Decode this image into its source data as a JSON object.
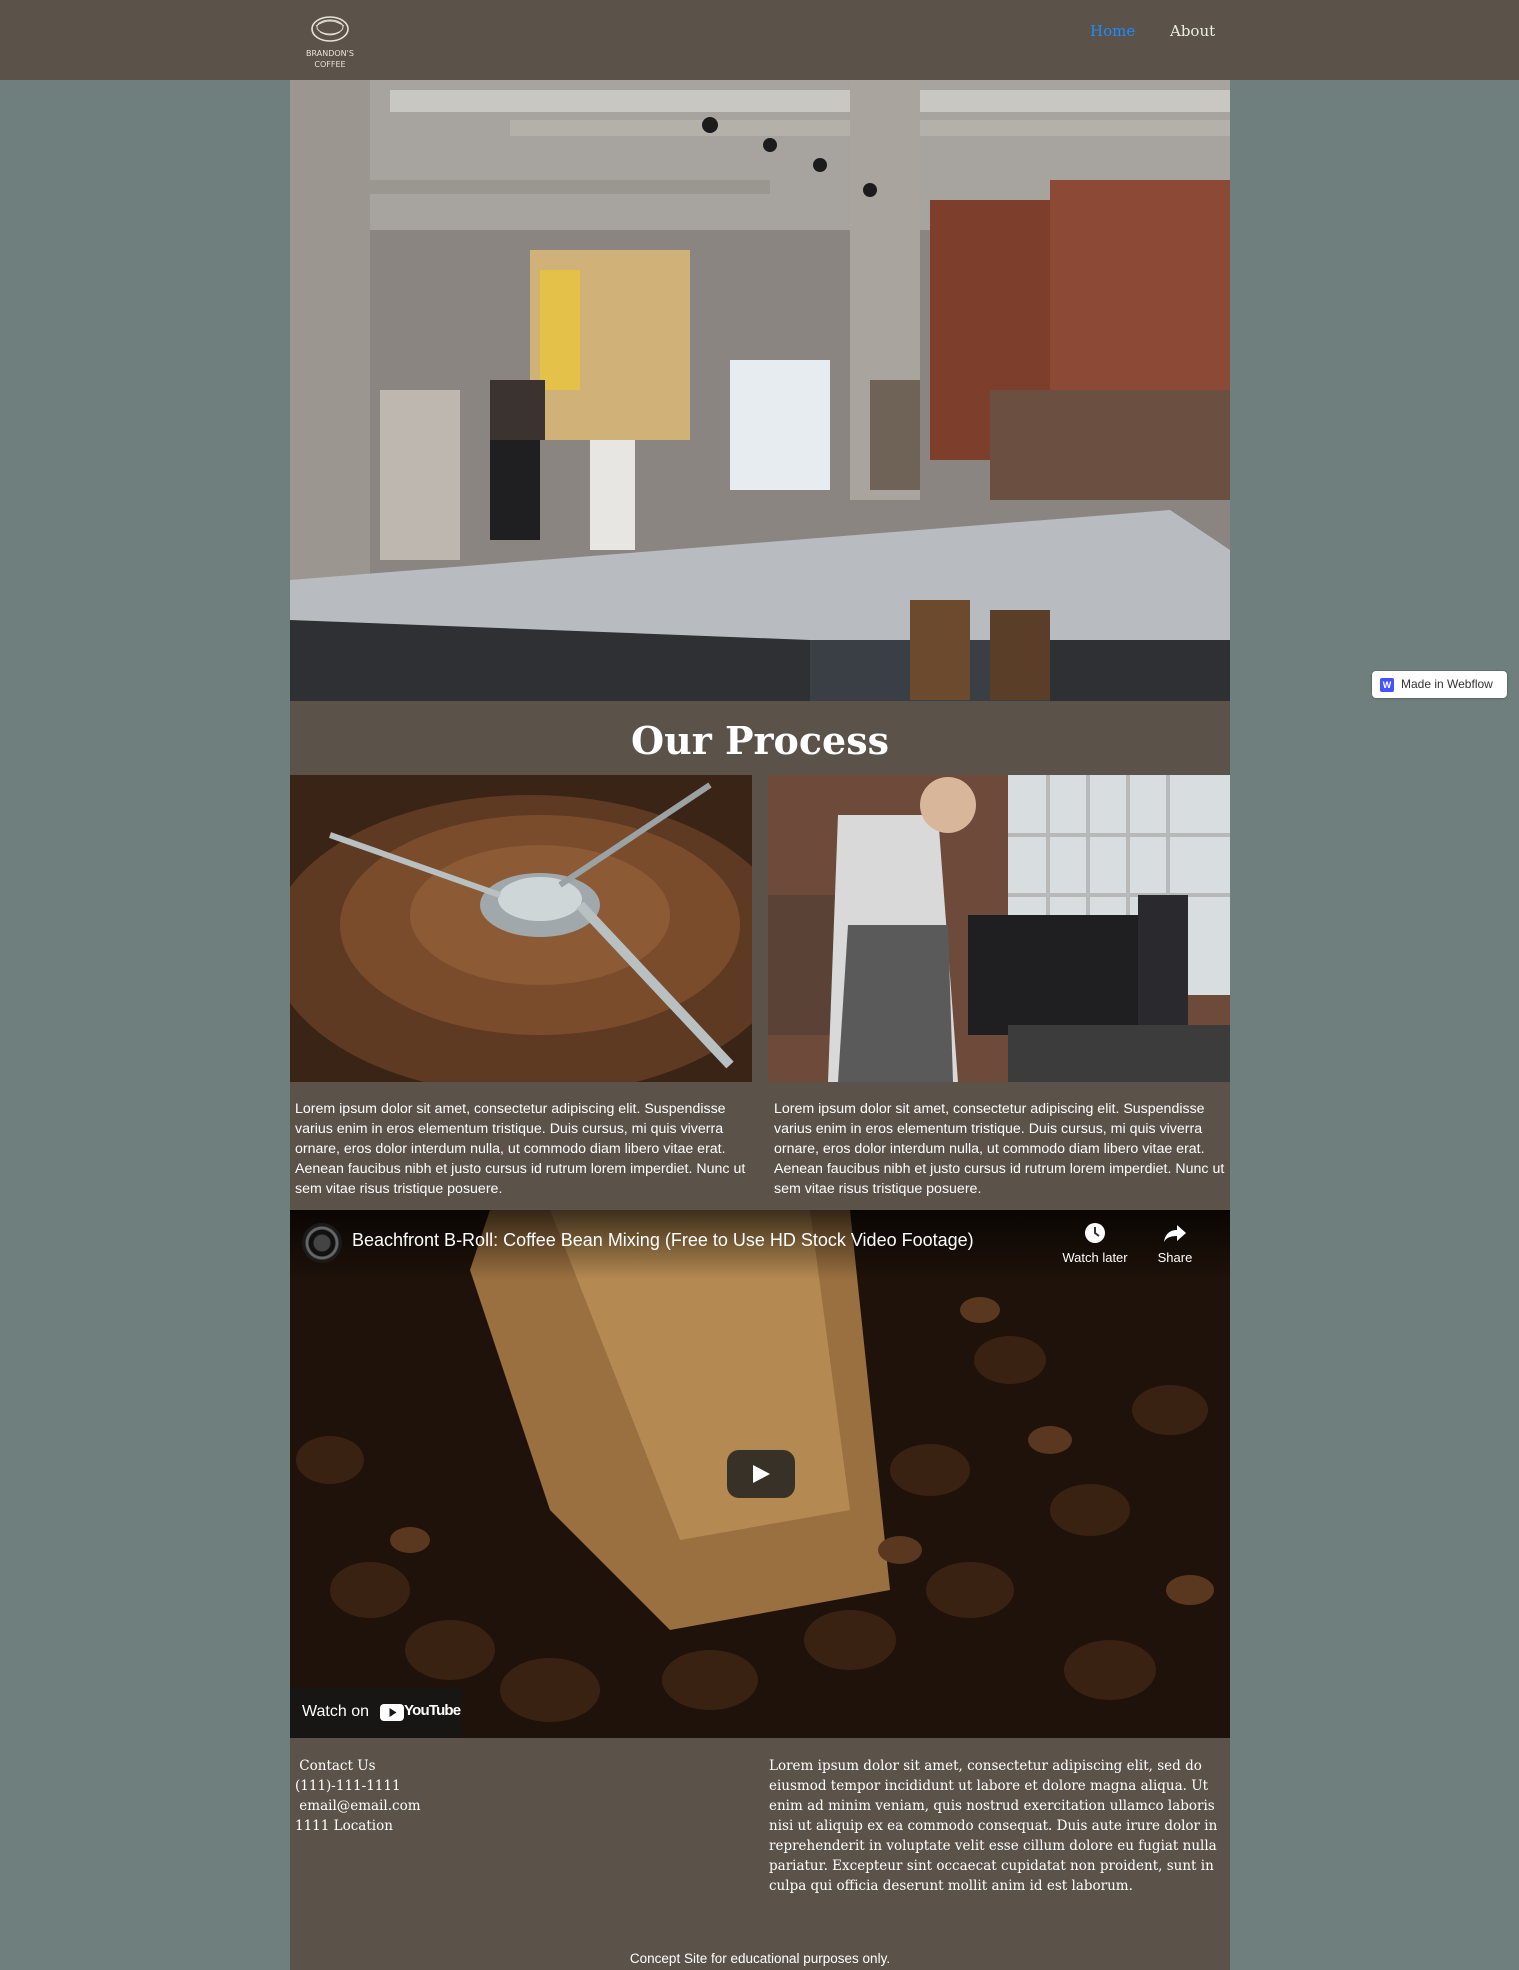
{
  "nav": {
    "logo_line1": "BRANDON'S",
    "logo_line2": "COFFEE",
    "links": [
      {
        "label": "Home",
        "active": true
      },
      {
        "label": "About",
        "active": false
      }
    ]
  },
  "process": {
    "title": "Our Process",
    "text_left": "Lorem ipsum dolor sit amet, consectetur adipiscing elit. Suspendisse varius enim in eros elementum tristique. Duis cursus, mi quis viverra ornare, eros dolor interdum nulla, ut commodo diam libero vitae erat. Aenean faucibus nibh et justo cursus id rutrum lorem imperdiet. Nunc ut sem vitae risus tristique posuere.",
    "text_right": "Lorem ipsum dolor sit amet, consectetur adipiscing elit. Suspendisse varius enim in eros elementum tristique. Duis cursus, mi quis viverra ornare, eros dolor interdum nulla, ut commodo diam libero vitae erat. Aenean faucibus nibh et justo cursus id rutrum lorem imperdiet. Nunc ut sem vitae risus tristique posuere."
  },
  "video": {
    "title": "Beachfront B-Roll: Coffee Bean Mixing (Free to Use HD Stock Video Footage)",
    "watch_later": "Watch later",
    "share": "Share",
    "watch_on": "Watch on",
    "youtube": "YouTube"
  },
  "footer": {
    "contact_title": " Contact Us",
    "phone": "(111)-111-1111",
    "email": " email@email.com",
    "location": "1111 Location",
    "paragraph": "Lorem ipsum dolor sit amet, consectetur adipiscing elit, sed do eiusmod tempor incididunt ut labore et dolore magna aliqua. Ut enim ad minim veniam, quis nostrud exercitation ullamco laboris nisi ut aliquip ex ea commodo consequat. Duis aute irure dolor in reprehenderit in voluptate velit esse cillum dolore eu fugiat nulla pariatur. Excepteur sint occaecat cupidatat non proident, sunt in culpa qui officia deserunt mollit anim id est laborum.",
    "note": "Concept Site for educational purposes only."
  },
  "badge": {
    "icon_letter": "W",
    "label": "Made in Webflow"
  },
  "colors": {
    "page_bg": "#6e7f7d",
    "panel_bg": "#5b524a",
    "active_link": "#1e8cff",
    "webflow_blue": "#4353ff"
  }
}
